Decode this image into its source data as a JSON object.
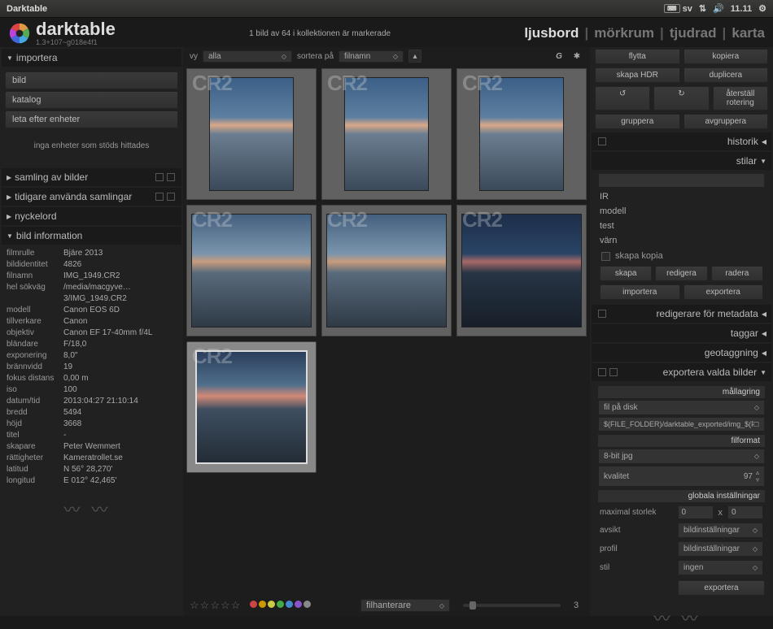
{
  "titlebar": {
    "app": "Darktable",
    "kb": "sv",
    "time": "11.11"
  },
  "header": {
    "brand": "darktable",
    "version": "1.3+107~g018e4f1",
    "status": "1 bild av 64 i kollektionen är markerade",
    "nav": {
      "lighttable": "ljusbord",
      "darkroom": "mörkrum",
      "tethering": "tjudrad",
      "map": "karta"
    }
  },
  "filter": {
    "vy": "vy",
    "vy_val": "alla",
    "sort": "sortera på",
    "sort_val": "filnamn",
    "g": "G"
  },
  "left": {
    "import_title": "importera",
    "import": {
      "image": "bild",
      "catalog": "katalog",
      "scan": "leta efter enheter",
      "none": "inga enheter som stöds hittades"
    },
    "panes": {
      "collect": "samling av bilder",
      "recent": "tidigare använda samlingar",
      "keyword": "nyckelord",
      "info": "bild information"
    },
    "info_keys": [
      "filmrulle",
      "bildidentitet",
      "filnamn",
      "hel sökväg",
      "modell",
      "tillverkare",
      "objektiv",
      "bländare",
      "exponering",
      "brännvidd",
      "fokus distans",
      "iso",
      "datum/tid",
      "bredd",
      "höjd",
      "titel",
      "skapare",
      "rättigheter",
      "latitud",
      "longitud"
    ],
    "info_vals": [
      "Bjäre 2013",
      "4826",
      "IMG_1949.CR2",
      "/media/macgyve…3/IMG_1949.CR2",
      "Canon EOS 6D",
      "Canon",
      "Canon EF 17-40mm f/4L",
      "F/18,0",
      "8,0\"",
      "19",
      "0,00 m",
      "100",
      "2013:04:27 21:10:14",
      "5494",
      "3668",
      "-",
      "Peter Wemmert",
      "Kameratrollet.se",
      "N 56° 28,270'",
      "E 012° 42,465'"
    ]
  },
  "right": {
    "btns": {
      "move": "flytta",
      "copy": "kopiera",
      "hdr": "skapa HDR",
      "dup": "duplicera",
      "rot_l": "↺",
      "rot_r": "↻",
      "reset_rot": "återställ rotering",
      "group": "gruppera",
      "ungroup": "avgruppera"
    },
    "panes": {
      "history": "historik",
      "styles": "stilar",
      "meta_edit": "redigerare för metadata",
      "tags": "taggar",
      "geo": "geotaggning",
      "export_sel": "exportera valda bilder"
    },
    "styles_list": [
      "IR",
      "modell",
      "test",
      "värn"
    ],
    "styles_copy": "skapa kopia",
    "styles_btns": {
      "create": "skapa",
      "edit": "redigera",
      "delete": "radera",
      "import": "importera",
      "export": "exportera"
    },
    "export": {
      "storage_hdr": "mållagring",
      "storage": "fil på disk",
      "path": "$(FILE_FOLDER)/darktable_exported/img_$(FIL",
      "format_hdr": "filformat",
      "format": "8-bit jpg",
      "quality_lbl": "kvalitet",
      "quality": "97",
      "global_hdr": "globala inställningar",
      "maxsize": "maximal storlek",
      "mx": "0",
      "by": "x",
      "my": "0",
      "intent": "avsikt",
      "intent_v": "bildinställningar",
      "profile": "profil",
      "profile_v": "bildinställningar",
      "style": "stil",
      "style_v": "ingen",
      "go": "exportera"
    }
  },
  "bottom": {
    "select": "filhanterare",
    "zoom": "3"
  },
  "thumbs": {
    "ext": "CR2"
  },
  "colors": {
    "dots": [
      "#c44",
      "#c90",
      "#cc4",
      "#4a4",
      "#48c",
      "#85c",
      "#888"
    ]
  }
}
